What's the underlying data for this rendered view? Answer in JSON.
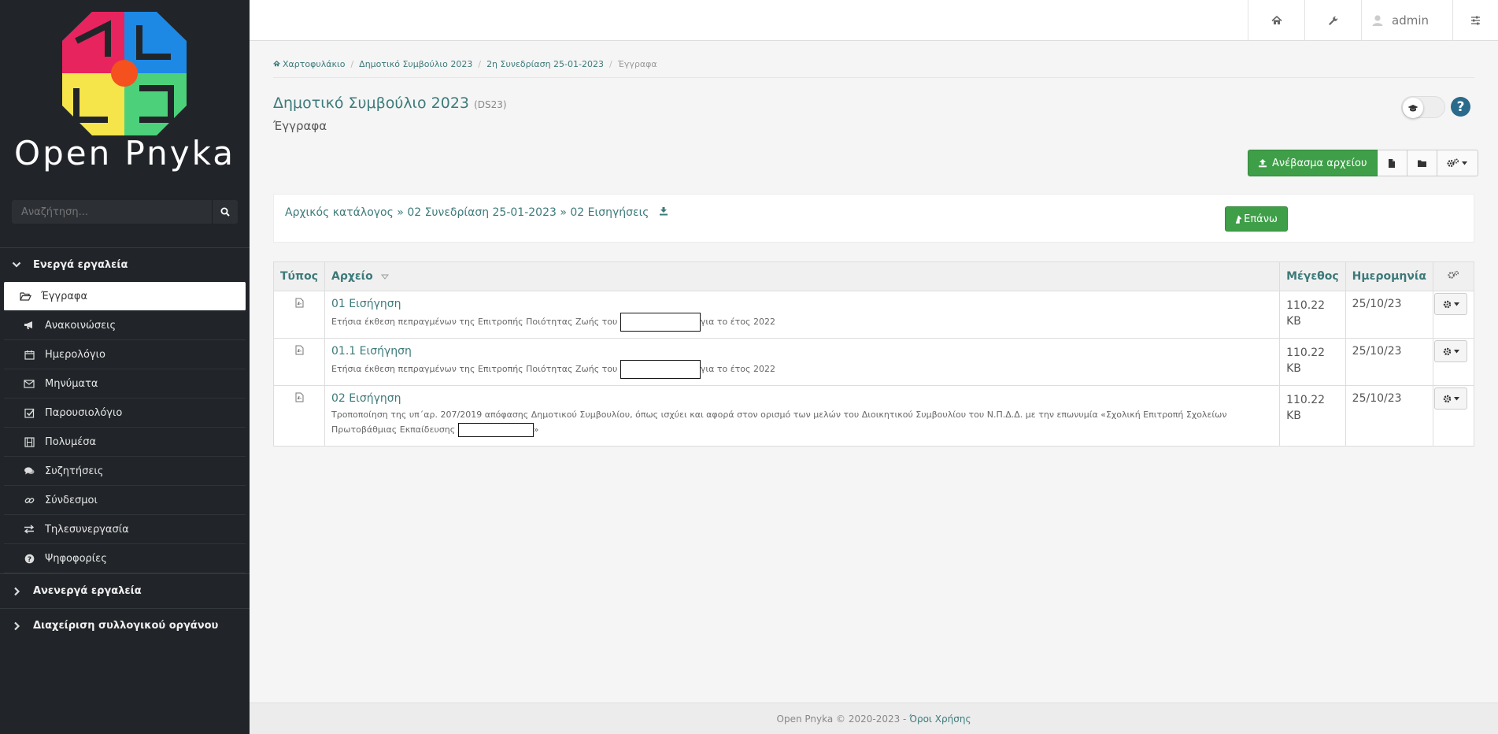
{
  "sidebar": {
    "logo_text": "Open Pnyka",
    "search_placeholder": "Αναζήτηση...",
    "group_active": "Ενεργά εργαλεία",
    "items": [
      {
        "label": "Έγγραφα",
        "icon": "folder-open-icon"
      },
      {
        "label": "Ανακοινώσεις",
        "icon": "bullhorn-icon"
      },
      {
        "label": "Ημερολόγιο",
        "icon": "calendar-icon"
      },
      {
        "label": "Μηνύματα",
        "icon": "envelope-icon"
      },
      {
        "label": "Παρουσιολόγιο",
        "icon": "check-square-icon"
      },
      {
        "label": "Πολυμέσα",
        "icon": "film-icon"
      },
      {
        "label": "Συζητήσεις",
        "icon": "comments-icon"
      },
      {
        "label": "Σύνδεσμοι",
        "icon": "link-icon"
      },
      {
        "label": "Τηλεσυνεργασία",
        "icon": "exchange-icon"
      },
      {
        "label": "Ψηφοφορίες",
        "icon": "question-circle-icon"
      }
    ],
    "group_inactive": "Ανενεργά εργαλεία",
    "group_admin": "Διαχείριση συλλογικού οργάνου"
  },
  "topbar": {
    "user": "admin"
  },
  "breadcrumb": {
    "home": "Χαρτοφυλάκιο",
    "b1": "Δημοτικό Συμβούλιο 2023",
    "b2": "2η Συνεδρίαση 25-01-2023",
    "current": "Έγγραφα"
  },
  "page": {
    "title": "Δημοτικό Συμβούλιο 2023",
    "code": "(DS23)",
    "subtitle": "Έγγραφα"
  },
  "actions": {
    "upload_label": "Ανέβασμα αρχείου",
    "up_label": "Επάνω"
  },
  "path": {
    "root": "Αρχικός κατάλογος",
    "sep": "»",
    "p1": "02 Συνεδρίαση 25-01-2023",
    "p2": "02 Εισηγήσεις"
  },
  "table": {
    "headers": {
      "type": "Τύπος",
      "file": "Αρχείο",
      "size": "Μέγεθος",
      "date": "Ημερομηνία"
    },
    "rows": [
      {
        "name": "01 Εισήγηση",
        "desc_a": "Ετήσια έκθεση πεπραγμένων της Επιτροπής Ποιότητας Ζωής του ",
        "desc_b": "για το έτος 2022",
        "size_num": "110.22",
        "size_unit": "KB",
        "date": "25/10/23"
      },
      {
        "name": "01.1 Εισήγηση",
        "desc_a": "Ετήσια έκθεση πεπραγμένων της Επιτροπής Ποιότητας Ζωής του ",
        "desc_b": "για το έτος 2022",
        "size_num": "110.22",
        "size_unit": "KB",
        "date": "25/10/23"
      },
      {
        "name": "02 Εισήγηση",
        "desc_a": "Τροποποίηση της υπ΄αρ. 207/2019 απόφασης Δημοτικού Συμβουλίου, όπως ισχύει και αφορά στον ορισμό των μελών του Διοικητικού Συμβουλίου του Ν.Π.Δ.Δ. με την επωνυμία «Σχολική Επιτροπή Σχολείων Πρωτοβάθμιας Εκπαίδευσης ",
        "desc_b": "»",
        "size_num": "110.22",
        "size_unit": "KB",
        "date": "25/10/23"
      }
    ]
  },
  "footer": {
    "text": "Open Pnyka © 2020-2023 - ",
    "link": "Όροι Χρήσης"
  }
}
